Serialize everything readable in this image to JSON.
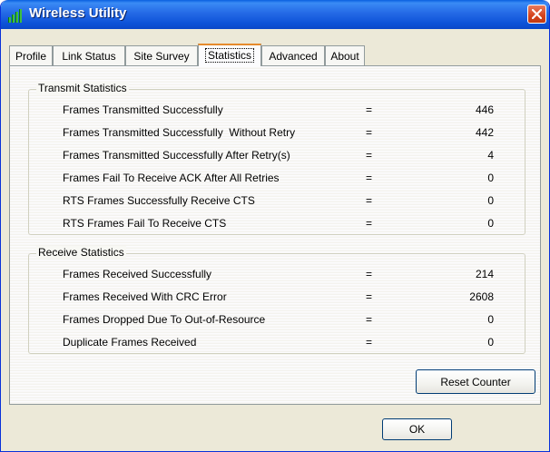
{
  "window": {
    "title": "Wireless Utility",
    "icon": "signal-bars-icon"
  },
  "tabs": [
    {
      "label": "Profile"
    },
    {
      "label": "Link Status"
    },
    {
      "label": "Site Survey"
    },
    {
      "label": "Statistics",
      "active": true
    },
    {
      "label": "Advanced"
    },
    {
      "label": "About"
    }
  ],
  "transmit": {
    "title": "Transmit Statistics",
    "rows": [
      {
        "label": "Frames Transmitted Successfully",
        "eq": "=",
        "value": "446"
      },
      {
        "label": "Frames Transmitted Successfully  Without Retry",
        "eq": "=",
        "value": "442"
      },
      {
        "label": "Frames Transmitted Successfully After Retry(s)",
        "eq": "=",
        "value": "4"
      },
      {
        "label": "Frames Fail To Receive ACK After All Retries",
        "eq": "=",
        "value": "0"
      },
      {
        "label": "RTS Frames Successfully Receive CTS",
        "eq": "=",
        "value": "0"
      },
      {
        "label": "RTS Frames Fail To Receive CTS",
        "eq": "=",
        "value": "0"
      }
    ]
  },
  "receive": {
    "title": "Receive Statistics",
    "rows": [
      {
        "label": "Frames Received Successfully",
        "eq": "=",
        "value": "214"
      },
      {
        "label": "Frames Received With CRC Error",
        "eq": "=",
        "value": "2608"
      },
      {
        "label": "Frames Dropped Due To Out-of-Resource",
        "eq": "=",
        "value": "0"
      },
      {
        "label": "Duplicate Frames Received",
        "eq": "=",
        "value": "0"
      }
    ]
  },
  "buttons": {
    "reset": "Reset Counter",
    "ok": "OK"
  },
  "colors": {
    "titlebar": "#0a5fe0",
    "close": "#d4431c",
    "dialog": "#ece9d8",
    "active_tab_accent": "#e68b2c"
  }
}
